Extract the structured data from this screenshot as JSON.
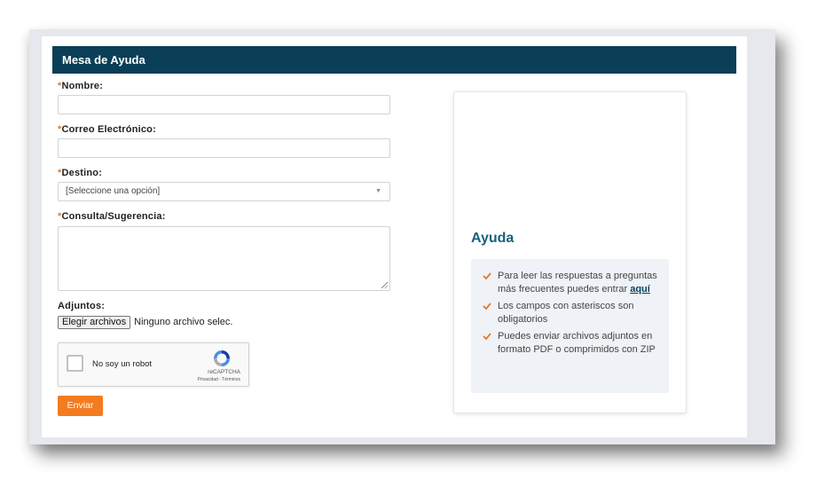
{
  "header": {
    "title": "Mesa de Ayuda"
  },
  "form": {
    "required_mark": "*",
    "name_label": "Nombre:",
    "email_label": "Correo Electrónico:",
    "destination_label": "Destino:",
    "destination_selected": "[Seleccione una opción]",
    "query_label": "Consulta/Sugerencia:",
    "attachments_label": "Adjuntos:",
    "file_button": "Elegir archivos",
    "file_status": "Ninguno archivo selec.",
    "submit_label": "Enviar"
  },
  "captcha": {
    "label": "No soy un robot",
    "brand": "reCAPTCHA",
    "links": "Privacidad - Términos"
  },
  "help": {
    "title": "Ayuda",
    "item1_text": "Para leer las respuestas a preguntas más frecuentes puedes entrar",
    "item1_link": "aquí",
    "item2_text": "Los campos con asteriscos son obligatorios",
    "item3_text": "Puedes enviar archivos adjuntos en formato PDF o comprimidos con ZIP"
  },
  "colors": {
    "header_bg": "#0a3f57",
    "accent": "#f47b20",
    "help_title": "#18607e"
  }
}
